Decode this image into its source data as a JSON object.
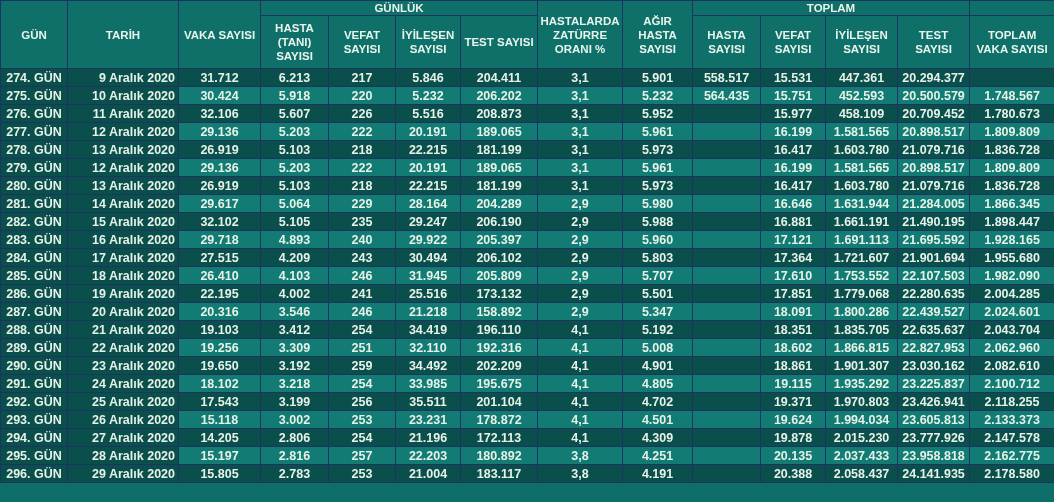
{
  "table": {
    "header": [
      {
        "kind": "single",
        "label": "GÜN"
      },
      {
        "kind": "single",
        "label": "TARİH"
      },
      {
        "kind": "single",
        "label": "VAKA SAYISI"
      },
      {
        "kind": "group",
        "label": "GÜNLÜK",
        "columns": [
          "HASTA (TANI) SAYISI",
          "VEFAT SAYISI",
          "İYİLEŞEN SAYISI",
          "TEST SAYISI"
        ]
      },
      {
        "kind": "single",
        "label": "HASTALARDA ZATÜRRE ORANI %"
      },
      {
        "kind": "single",
        "label": "AĞIR HASTA SAYISI"
      },
      {
        "kind": "group",
        "label": "TOPLAM",
        "columns": [
          "HASTA SAYISI",
          "VEFAT SAYISI",
          "İYİLEŞEN SAYISI",
          "TEST SAYISI"
        ]
      },
      {
        "kind": "lower",
        "label": "TOPLAM VAKA SAYISI"
      }
    ],
    "rows": [
      [
        "274. GÜN",
        "9 Aralık 2020",
        "31.712",
        "6.213",
        "217",
        "5.846",
        "204.411",
        "3,1",
        "5.901",
        "558.517",
        "15.531",
        "447.361",
        "20.294.377",
        null
      ],
      [
        "275. GÜN",
        "10 Aralık 2020",
        "30.424",
        "5.918",
        "220",
        "5.232",
        "206.202",
        "3,1",
        "5.232",
        "564.435",
        "15.751",
        "452.593",
        "20.500.579",
        "1.748.567"
      ],
      [
        "276. GÜN",
        "11 Aralık 2020",
        "32.106",
        "5.607",
        "226",
        "5.516",
        "208.873",
        "3,1",
        "5.952",
        null,
        "15.977",
        "458.109",
        "20.709.452",
        "1.780.673"
      ],
      [
        "277. GÜN",
        "12 Aralık 2020",
        "29.136",
        "5.203",
        "222",
        "20.191",
        "189.065",
        "3,1",
        "5.961",
        null,
        "16.199",
        "1.581.565",
        "20.898.517",
        "1.809.809"
      ],
      [
        "278. GÜN",
        "13 Aralık 2020",
        "26.919",
        "5.103",
        "218",
        "22.215",
        "181.199",
        "3,1",
        "5.973",
        null,
        "16.417",
        "1.603.780",
        "21.079.716",
        "1.836.728"
      ],
      [
        "279. GÜN",
        "12 Aralık 2020",
        "29.136",
        "5.203",
        "222",
        "20.191",
        "189.065",
        "3,1",
        "5.961",
        null,
        "16.199",
        "1.581.565",
        "20.898.517",
        "1.809.809"
      ],
      [
        "280. GÜN",
        "13 Aralık 2020",
        "26.919",
        "5.103",
        "218",
        "22.215",
        "181.199",
        "3,1",
        "5.973",
        null,
        "16.417",
        "1.603.780",
        "21.079.716",
        "1.836.728"
      ],
      [
        "281. GÜN",
        "14 Aralık 2020",
        "29.617",
        "5.064",
        "229",
        "28.164",
        "204.289",
        "2,9",
        "5.980",
        null,
        "16.646",
        "1.631.944",
        "21.284.005",
        "1.866.345"
      ],
      [
        "282. GÜN",
        "15 Aralık 2020",
        "32.102",
        "5.105",
        "235",
        "29.247",
        "206.190",
        "2,9",
        "5.988",
        null,
        "16.881",
        "1.661.191",
        "21.490.195",
        "1.898.447"
      ],
      [
        "283. GÜN",
        "16 Aralık 2020",
        "29.718",
        "4.893",
        "240",
        "29.922",
        "205.397",
        "2,9",
        "5.960",
        null,
        "17.121",
        "1.691.113",
        "21.695.592",
        "1.928.165"
      ],
      [
        "284. GÜN",
        "17 Aralık 2020",
        "27.515",
        "4.209",
        "243",
        "30.494",
        "206.102",
        "2,9",
        "5.803",
        null,
        "17.364",
        "1.721.607",
        "21.901.694",
        "1.955.680"
      ],
      [
        "285. GÜN",
        "18 Aralık 2020",
        "26.410",
        "4.103",
        "246",
        "31.945",
        "205.809",
        "2,9",
        "5.707",
        null,
        "17.610",
        "1.753.552",
        "22.107.503",
        "1.982.090"
      ],
      [
        "286. GÜN",
        "19 Aralık 2020",
        "22.195",
        "4.002",
        "241",
        "25.516",
        "173.132",
        "2,9",
        "5.501",
        null,
        "17.851",
        "1.779.068",
        "22.280.635",
        "2.004.285"
      ],
      [
        "287. GÜN",
        "20 Aralık 2020",
        "20.316",
        "3.546",
        "246",
        "21.218",
        "158.892",
        "2,9",
        "5.347",
        null,
        "18.091",
        "1.800.286",
        "22.439.527",
        "2.024.601"
      ],
      [
        "288. GÜN",
        "21 Aralık 2020",
        "19.103",
        "3.412",
        "254",
        "34.419",
        "196.110",
        "4,1",
        "5.192",
        null,
        "18.351",
        "1.835.705",
        "22.635.637",
        "2.043.704"
      ],
      [
        "289. GÜN",
        "22 Aralık 2020",
        "19.256",
        "3.309",
        "251",
        "32.110",
        "192.316",
        "4,1",
        "5.008",
        null,
        "18.602",
        "1.866.815",
        "22.827.953",
        "2.062.960"
      ],
      [
        "290. GÜN",
        "23 Aralık 2020",
        "19.650",
        "3.192",
        "259",
        "34.492",
        "202.209",
        "4,1",
        "4.901",
        null,
        "18.861",
        "1.901.307",
        "23.030.162",
        "2.082.610"
      ],
      [
        "291. GÜN",
        "24 Aralık 2020",
        "18.102",
        "3.218",
        "254",
        "33.985",
        "195.675",
        "4,1",
        "4.805",
        null,
        "19.115",
        "1.935.292",
        "23.225.837",
        "2.100.712"
      ],
      [
        "292. GÜN",
        "25 Aralık 2020",
        "17.543",
        "3.199",
        "256",
        "35.511",
        "201.104",
        "4,1",
        "4.702",
        null,
        "19.371",
        "1.970.803",
        "23.426.941",
        "2.118.255"
      ],
      [
        "293. GÜN",
        "26 Aralık 2020",
        "15.118",
        "3.002",
        "253",
        "23.231",
        "178.872",
        "4,1",
        "4.501",
        null,
        "19.624",
        "1.994.034",
        "23.605.813",
        "2.133.373"
      ],
      [
        "294. GÜN",
        "27 Aralık 2020",
        "14.205",
        "2.806",
        "254",
        "21.196",
        "172.113",
        "4,1",
        "4.309",
        null,
        "19.878",
        "2.015.230",
        "23.777.926",
        "2.147.578"
      ],
      [
        "295. GÜN",
        "28 Aralık 2020",
        "15.197",
        "2.816",
        "257",
        "22.203",
        "180.892",
        "3,8",
        "4.251",
        null,
        "20.135",
        "2.037.433",
        "23.958.818",
        "2.162.775"
      ],
      [
        "296. GÜN",
        "29 Aralık 2020",
        "15.805",
        "2.783",
        "253",
        "21.004",
        "183.117",
        "3,8",
        "4.191",
        null,
        "20.388",
        "2.058.437",
        "24.141.935",
        "2.178.580"
      ]
    ]
  }
}
